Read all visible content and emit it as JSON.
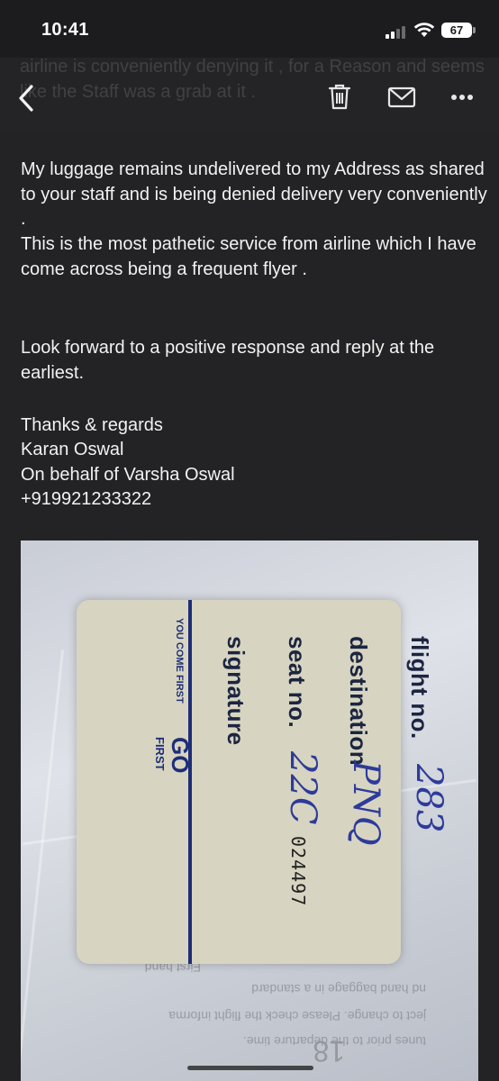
{
  "status_bar": {
    "time": "10:41",
    "battery": "67"
  },
  "header": {
    "ghost_text": "The luggage contains Gold Ornaments which seems the airline is conveniently denying it , for a Reason and seems like the Staff was a grab at it ."
  },
  "message": {
    "paragraph1": "My luggage remains undelivered to my Address as shared to your staff and is being denied delivery very conveniently .",
    "paragraph2": "This is the most pathetic service from airline which I have come across being a frequent flyer .",
    "paragraph3": "Look forward to a positive response and reply at the earliest.",
    "sign_off": "Thanks & regards",
    "name": "Karan Oswal",
    "on_behalf": "On behalf of Varsha Oswal",
    "phone": "+919921233322"
  },
  "photo": {
    "tag_labels": [
      "flight no.",
      "destination",
      "seat no.",
      "signature"
    ],
    "handwritten": {
      "flight": "283",
      "destination": "PNQ",
      "seat": "22C"
    },
    "serial": "024497",
    "brand_slogan": "YOU COME FIRST",
    "brand_go": "GO",
    "brand_first": "FIRST",
    "underlying_text": [
      "tunes prior to the departure time.",
      "ject to change. Please check the flight informa",
      "nd hand baggage in a standard",
      "First hand",
      "18"
    ]
  },
  "icons": [
    "back-chevron-icon",
    "trash-icon",
    "mail-icon",
    "more-icon",
    "wifi-icon",
    "signal-icon",
    "battery-icon"
  ]
}
